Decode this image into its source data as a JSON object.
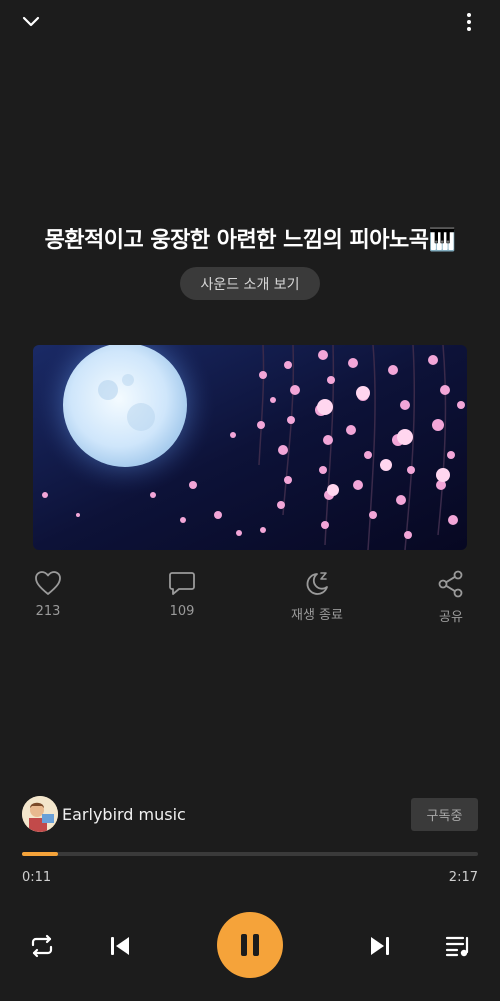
{
  "track": {
    "title": "몽환적이고 웅장한 아련한 느낌의 피아노곡🎹",
    "sound_intro_label": "사운드 소개 보기"
  },
  "actions": {
    "likes": "213",
    "comments": "109",
    "sleep_label": "재생 종료",
    "share_label": "공유"
  },
  "artist": {
    "name": "Earlybird music",
    "subscribe_label": "구독중"
  },
  "playback": {
    "current_time": "0:11",
    "total_time": "2:17",
    "progress_fraction": 0.08,
    "state": "playing"
  },
  "colors": {
    "accent": "#f5a33a",
    "background": "#1c1c1c"
  },
  "icons": {
    "top_left": "chevron-down-icon",
    "top_right": "more-vertical-icon",
    "like": "heart-icon",
    "comment": "comment-icon",
    "sleep": "moon-sleep-icon",
    "share": "share-icon",
    "repeat": "repeat-icon",
    "previous": "skip-previous-icon",
    "pause": "pause-icon",
    "next": "skip-next-icon",
    "playlist": "playlist-icon"
  }
}
